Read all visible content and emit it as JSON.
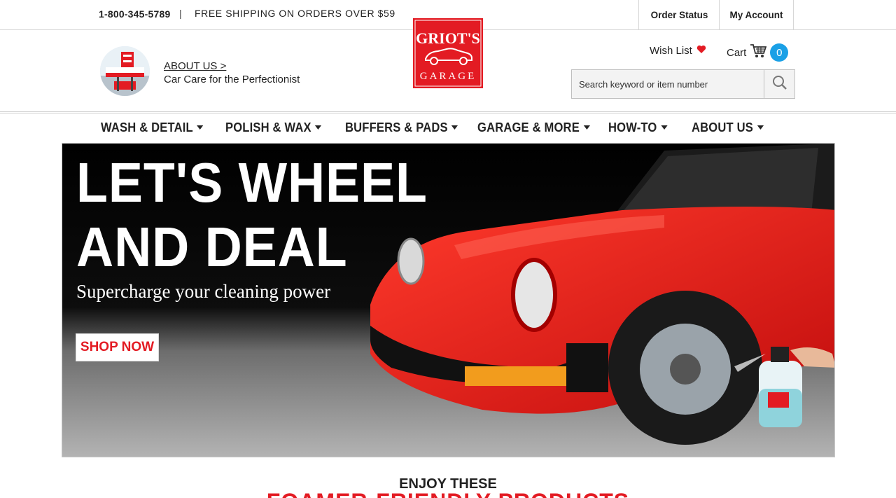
{
  "topbar": {
    "phone": "1-800-345-5789",
    "separator": "|",
    "shipping": "FREE SHIPPING ON ORDERS OVER $59",
    "order_status": "Order Status",
    "my_account": "My Account"
  },
  "header": {
    "about_link": "ABOUT US >",
    "about_tagline": "Car Care for the Perfectionist",
    "logo_line1": "GRIOT'S",
    "logo_line2": "GARAGE",
    "wishlist_label": "Wish List",
    "cart_label": "Cart",
    "cart_count": "0",
    "search_placeholder": "Search keyword or item number"
  },
  "nav": {
    "items": [
      {
        "label": "WASH & DETAIL"
      },
      {
        "label": "POLISH & WAX"
      },
      {
        "label": "BUFFERS & PADS"
      },
      {
        "label": "GARAGE & MORE"
      },
      {
        "label": "HOW-TO"
      },
      {
        "label": "ABOUT US"
      }
    ]
  },
  "hero": {
    "headline_line1": "LET'S WHEEL",
    "headline_line2": "AND DEAL",
    "subheadline": "Supercharge your cleaning power",
    "cta": "SHOP NOW"
  },
  "section": {
    "kicker": "ENJOY THESE",
    "title": "FOAMER-FRIENDLY PRODUCTS"
  },
  "colors": {
    "brand_red": "#e31b23",
    "cart_badge": "#1aa0e6",
    "hero_bg": "#000000"
  }
}
